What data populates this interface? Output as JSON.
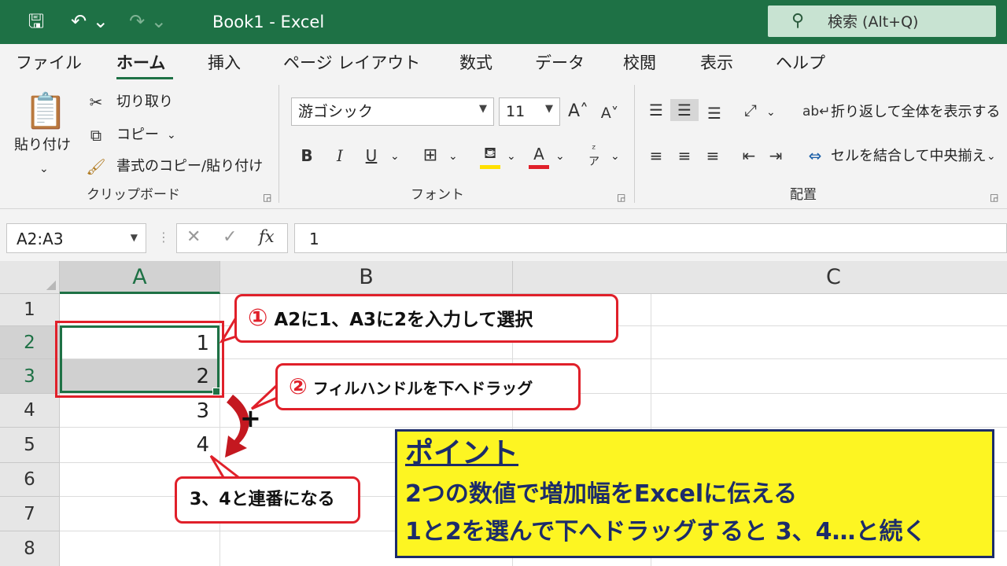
{
  "titlebar": {
    "title": "Book1  -  Excel",
    "search_placeholder": "検索 (Alt+Q)",
    "save_icon": "save-icon",
    "undo_icon": "undo-icon",
    "redo_icon": "redo-icon"
  },
  "ribbon": {
    "tabs": [
      {
        "label": "ファイル",
        "active": false
      },
      {
        "label": "ホーム",
        "active": true
      },
      {
        "label": "挿入",
        "active": false
      },
      {
        "label": "ページ レイアウト",
        "active": false
      },
      {
        "label": "数式",
        "active": false
      },
      {
        "label": "データ",
        "active": false
      },
      {
        "label": "校閲",
        "active": false
      },
      {
        "label": "表示",
        "active": false
      },
      {
        "label": "ヘルプ",
        "active": false
      }
    ],
    "clipboard": {
      "paste": "貼り付け",
      "cut": "切り取り",
      "copy": "コピー",
      "format_painter": "書式のコピー/貼り付け",
      "group_label": "クリップボード"
    },
    "font": {
      "font_name": "游ゴシック",
      "font_size": "11",
      "bold": "B",
      "italic": "I",
      "underline": "U",
      "font_color": "A",
      "group_label": "フォント"
    },
    "alignment": {
      "wrap_text": "折り返して全体を表示する",
      "merge_center": "セルを結合して中央揃え",
      "group_label": "配置"
    }
  },
  "formula_bar": {
    "name_box": "A2:A3",
    "cancel": "✕",
    "enter": "✓",
    "fx": "fx",
    "value": "1"
  },
  "sheet": {
    "columns": [
      "A",
      "B",
      "C"
    ],
    "rows": [
      "1",
      "2",
      "3",
      "4",
      "5",
      "6",
      "7",
      "8"
    ],
    "cells": {
      "A2": "1",
      "A3": "2",
      "A4": "3",
      "A5": "4"
    },
    "selected_range": "A2:A3"
  },
  "annotations": {
    "step1_num": "①",
    "step1": "A2に1、A3に2を入力して選択",
    "step2_num": "②",
    "step2": "フィルハンドルを下へドラッグ",
    "result": "3、4と連番になる",
    "point_title": "ポイント",
    "point_line1": "2つの数値で増加幅をExcelに伝える",
    "point_line2": "1と2を選んで下へドラッグすると 3、4…と続く"
  },
  "colors": {
    "excel_green": "#1e7145",
    "annotation_red": "#e0202a",
    "point_yellow": "#fdf522",
    "point_navy": "#1c2c6a"
  }
}
